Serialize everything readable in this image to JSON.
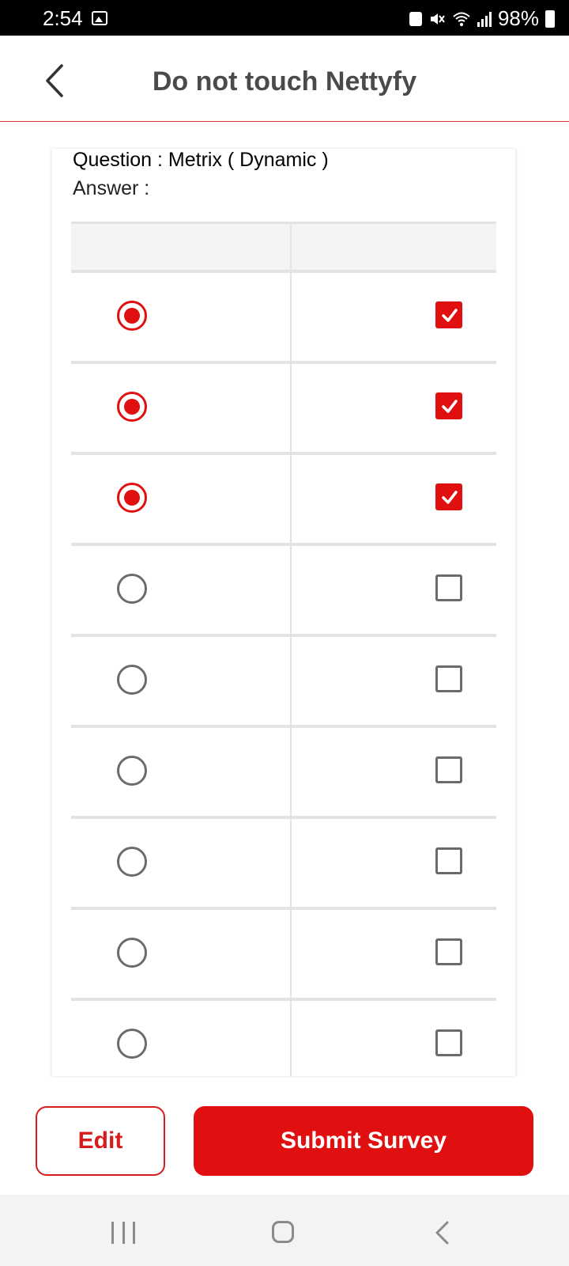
{
  "status_bar": {
    "time": "2:54",
    "battery": "98%"
  },
  "app_bar": {
    "title": "Do not touch Nettyfy"
  },
  "question": {
    "label": "Question : Metrix ( Dynamic )",
    "answer_label": "Answer :"
  },
  "matrix": {
    "rows": [
      {
        "radio_selected": true,
        "checkbox_checked": true
      },
      {
        "radio_selected": true,
        "checkbox_checked": true
      },
      {
        "radio_selected": true,
        "checkbox_checked": true
      },
      {
        "radio_selected": false,
        "checkbox_checked": false
      },
      {
        "radio_selected": false,
        "checkbox_checked": false
      },
      {
        "radio_selected": false,
        "checkbox_checked": false
      },
      {
        "radio_selected": false,
        "checkbox_checked": false
      },
      {
        "radio_selected": false,
        "checkbox_checked": false
      },
      {
        "radio_selected": false,
        "checkbox_checked": false
      }
    ]
  },
  "buttons": {
    "edit": "Edit",
    "submit": "Submit Survey"
  },
  "colors": {
    "accent": "#e01010",
    "divider": "#e3e3e3",
    "status_bar": "#000000"
  },
  "icons": {
    "back": "chevron-left-icon",
    "gallery": "image-icon",
    "nav_recents": "recents-icon",
    "nav_home": "home-icon",
    "nav_back": "back-icon"
  }
}
